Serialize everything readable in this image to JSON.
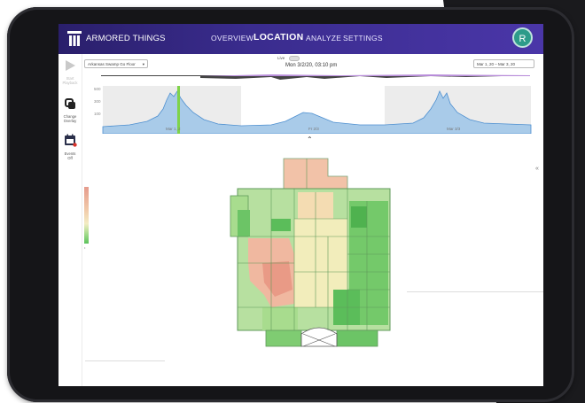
{
  "brand": {
    "name": "ARMORED THINGS"
  },
  "nav": {
    "items": [
      {
        "label": "OVERVIEW",
        "active": false
      },
      {
        "label": "LOCATION",
        "active": true
      },
      {
        "label": "ANALYZE",
        "active": false
      },
      {
        "label": "SETTINGS",
        "active": false
      }
    ]
  },
  "user": {
    "initial": "R"
  },
  "sidebar": {
    "items": [
      {
        "label_1": "Start",
        "label_2": "Playback",
        "icon": "play-icon",
        "enabled": false
      },
      {
        "label_1": "Change",
        "label_2": "Overlay",
        "icon": "layers-icon",
        "enabled": true
      },
      {
        "label_1": "Events",
        "label_2": "Off",
        "icon": "calendar-icon",
        "enabled": true
      }
    ]
  },
  "controls": {
    "layout_select": "Arkansas Swamp Go Floor",
    "live_label": "Live",
    "timestamp": "Mon 3/2/20, 03:10 pm",
    "range_start": "Mar 1, 20",
    "range_end": "Mar 3, 20"
  },
  "timeline": {
    "y_ticks": [
      "500",
      "300",
      "100"
    ],
    "date_labels": [
      "Mar 1, 2",
      "Fr 2/3",
      "Mar 3/3"
    ]
  },
  "colors": {
    "accent": "#3a2c8e",
    "scrubber": "#7fd34a",
    "chart_fill": "#9ec4e6",
    "chart_line": "#4d8fd0"
  }
}
